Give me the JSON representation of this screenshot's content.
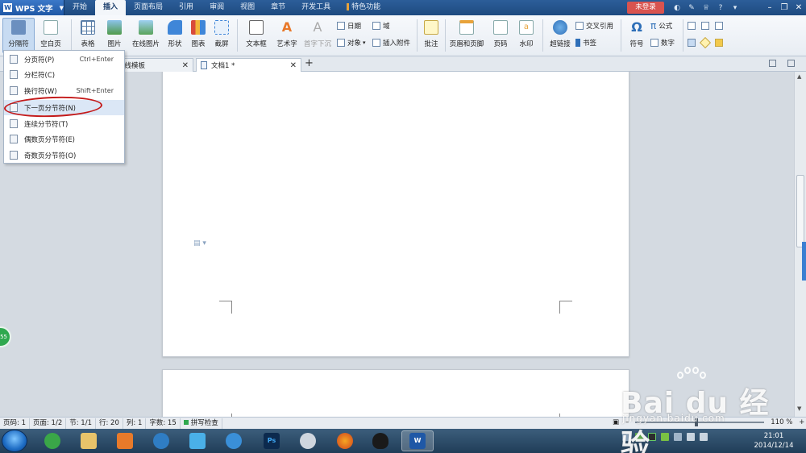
{
  "menubar": {
    "app_name": "WPS 文字",
    "tabs": [
      "开始",
      "插入",
      "页面布局",
      "引用",
      "审阅",
      "视图",
      "章节",
      "开发工具",
      "特色功能"
    ],
    "active_tab": "插入",
    "login_label": "未登录"
  },
  "ribbon": {
    "fengefu": "分隔符",
    "kongbaiye": "空白页",
    "biaoge": "表格",
    "tupian": "图片",
    "zaixian_tupian": "在线图片",
    "xingzhuang": "形状",
    "tubiao": "图表",
    "jieping": "截屏",
    "wenbenkuang": "文本框",
    "yishuzi": "艺术字",
    "shouzi_xiachen": "首字下沉",
    "riqi": "日期",
    "duixiang": "对象",
    "yu": "域",
    "charu_fujian": "插入附件",
    "pizhu": "批注",
    "yemei_yejiao": "页眉和页脚",
    "yema": "页码",
    "shuiyin": "水印",
    "chaolianjie": "超链接",
    "jiaocha_yinyong": "交叉引用",
    "shuqian": "书签",
    "fuhao": "符号",
    "gongshi": "公式",
    "shuzi": "数字"
  },
  "dropdown": {
    "items": [
      {
        "label": "分页符(P)",
        "shortcut": "Ctrl+Enter"
      },
      {
        "label": "分栏符(C)",
        "shortcut": ""
      },
      {
        "label": "换行符(W)",
        "shortcut": "Shift+Enter"
      },
      {
        "label": "下一页分节符(N)",
        "shortcut": ""
      },
      {
        "label": "连续分节符(T)",
        "shortcut": ""
      },
      {
        "label": "偶数页分节符(E)",
        "shortcut": ""
      },
      {
        "label": "奇数页分节符(O)",
        "shortcut": ""
      }
    ],
    "highlighted_index": 3
  },
  "tabs": {
    "tab1": "在线模板",
    "tab2": "文档1 *"
  },
  "status": {
    "page_no": "页码: 1",
    "pages": "页面: 1/2",
    "section": "节: 1/1",
    "row": "行: 20",
    "col": "列: 1",
    "words": "字数: 15",
    "spell": "拼写检查",
    "zoom": "110 %"
  },
  "taskbar": {
    "time": "21:01",
    "date": "2014/12/14",
    "ps_label": "Ps",
    "wps_label": "W"
  },
  "watermark": {
    "big": "Bai du 经验",
    "url": "jingyan.baidu.com"
  },
  "side_badge": "55",
  "colors": {
    "menubar_bg": "#1e4a80",
    "login_btn": "#d9534f",
    "annotation_red": "#c41a1a",
    "highlight": "#dbe7f6"
  }
}
